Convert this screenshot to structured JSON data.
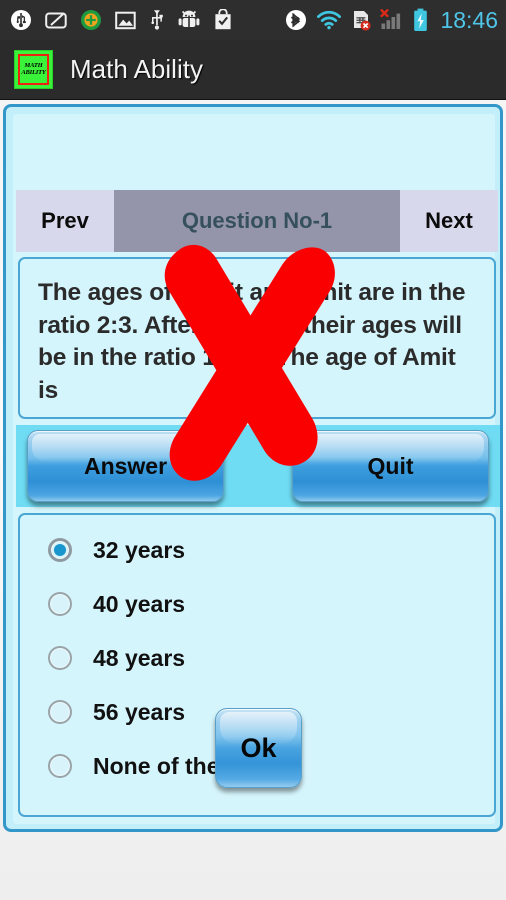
{
  "status_bar": {
    "time": "18:46",
    "left_icons": [
      "usb-debug-icon",
      "screenshot-icon",
      "updates-icon",
      "image-icon",
      "usb-icon",
      "android-debug-bug-icon",
      "play-store-bag-icon"
    ],
    "right_icons": [
      "bluetooth-icon",
      "wifi-icon",
      "sim-card-error-icon",
      "cellular-signal-no-service-icon",
      "battery-charging-icon"
    ],
    "clock_color": "#4fc5e8",
    "bar_color": "#2e2e2e"
  },
  "action_bar": {
    "app_title": "Math Ability",
    "app_icon": {
      "name": "math-ability-app-icon",
      "line1": "MATH",
      "line2": "ABILITY",
      "background": "#3bf23b",
      "border": "#ee2211"
    }
  },
  "nav": {
    "prev_label": "Prev",
    "question_label": "Question No-1",
    "next_label": "Next",
    "side_button_color": "#d8d8ec",
    "center_color": "#9494ab",
    "center_text_color": "#36505e"
  },
  "question": {
    "text": "The ages of Mohit and Amit are in the ratio 2:3. After 9 years, their ages will be in the ratio 11:15. The age of Amit is",
    "panel_background": "#d5f5fc",
    "panel_border": "#4aa7d4"
  },
  "actions": {
    "answer_label": "Answer",
    "quit_label": "Quit",
    "strip_background": "#6fdcf4"
  },
  "options": {
    "selected_index": 0,
    "items": [
      {
        "label": "32 years",
        "checked": true
      },
      {
        "label": "40 years",
        "checked": false
      },
      {
        "label": "48 years",
        "checked": false
      },
      {
        "label": "56 years",
        "checked": false
      },
      {
        "label": "None of these",
        "checked": false
      }
    ],
    "ok_label": "Ok",
    "radio_fill_color": "#1a96cf"
  },
  "overlay": {
    "mark": "red-x-cross-overlay",
    "color": "#fa0000"
  },
  "theme": {
    "panel_cyan": "#d5f5fc",
    "panel_border": "#3497c9",
    "button_blue": "#2e8fd6"
  }
}
